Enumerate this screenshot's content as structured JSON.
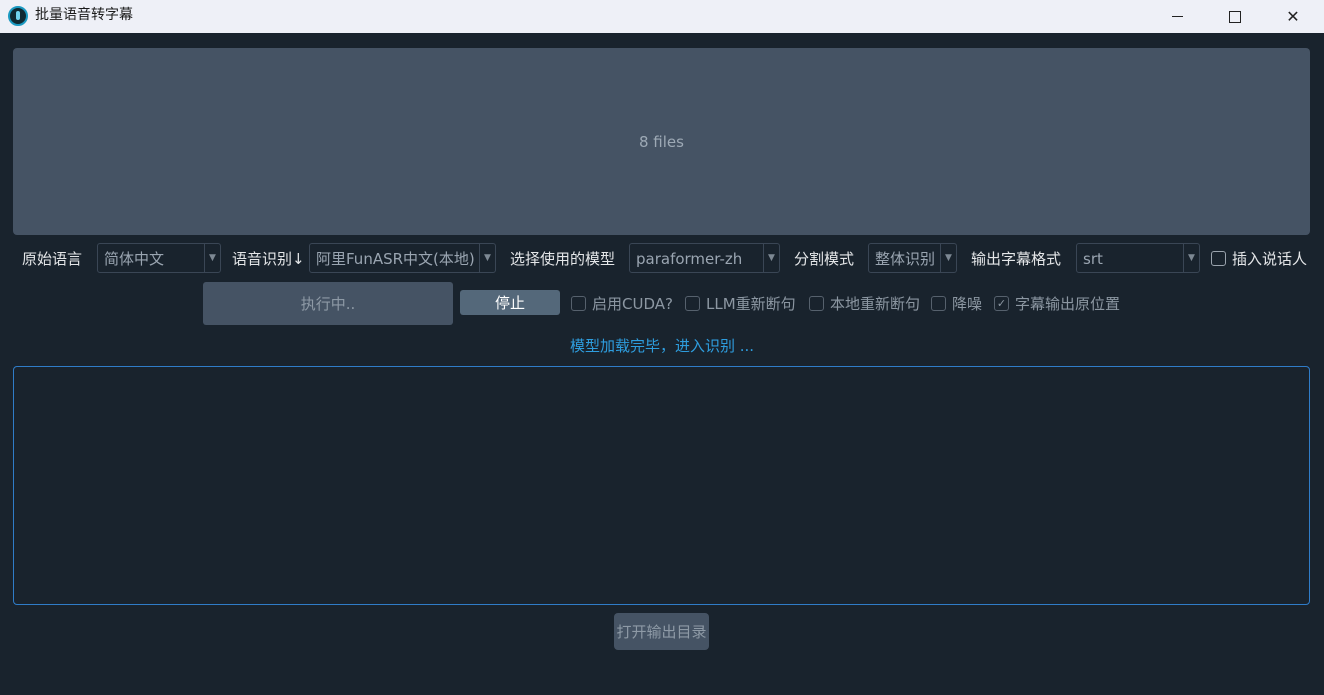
{
  "window": {
    "title": "批量语音转字幕",
    "controls": {
      "minimize": "─",
      "maximize": "☐",
      "close": "✕"
    }
  },
  "dropzone": {
    "text": "8 files"
  },
  "options": {
    "source_language": {
      "label": "原始语言",
      "value": "简体中文"
    },
    "recognition": {
      "label": "语音识别↓",
      "value": "阿里FunASR中文(本地)"
    },
    "model": {
      "label": "选择使用的模型",
      "value": "paraformer-zh"
    },
    "split_mode": {
      "label": "分割模式",
      "value": "整体识别"
    },
    "subtitle_format": {
      "label": "输出字幕格式",
      "value": "srt"
    },
    "insert_speaker": {
      "label": "插入说话人",
      "checked": false
    }
  },
  "actions": {
    "run_label": "执行中..",
    "stop_label": "停止",
    "open_output_label": "打开输出目录"
  },
  "checkboxes": [
    {
      "label": "启用CUDA?",
      "checked": false,
      "icon": "checkbox-unchecked-icon"
    },
    {
      "label": "LLM重新断句",
      "checked": false,
      "icon": "checkbox-unchecked-icon"
    },
    {
      "label": "本地重新断句",
      "checked": false,
      "icon": "checkbox-unchecked-icon"
    },
    {
      "label": "降噪",
      "checked": false,
      "icon": "checkbox-unchecked-icon"
    },
    {
      "label": "字幕输出原位置",
      "checked": true,
      "icon": "checkbox-checked-icon"
    }
  ],
  "status": {
    "text": "模型加载完毕，进入识别 ..."
  },
  "colors": {
    "background": "#19232d",
    "panel": "#455364",
    "accent": "#2e9dde",
    "titlebar": "#eef0f7"
  }
}
